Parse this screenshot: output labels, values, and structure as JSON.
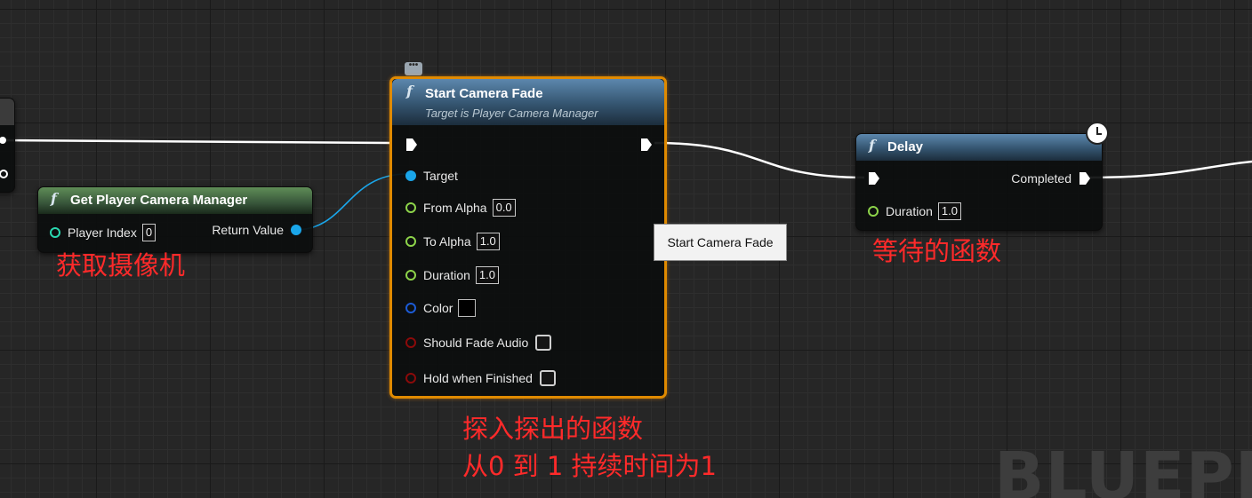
{
  "nodes": {
    "get_camera_manager": {
      "title": "Get Player Camera Manager",
      "player_index_label": "Player Index",
      "player_index_value": "0",
      "return_value_label": "Return Value"
    },
    "start_camera_fade": {
      "title": "Start Camera Fade",
      "subtitle": "Target is Player Camera Manager",
      "target_label": "Target",
      "from_alpha_label": "From Alpha",
      "from_alpha_value": "0.0",
      "to_alpha_label": "To Alpha",
      "to_alpha_value": "1.0",
      "duration_label": "Duration",
      "duration_value": "1.0",
      "color_label": "Color",
      "color_value": "#000000",
      "should_fade_audio_label": "Should Fade Audio",
      "should_fade_audio_checked": false,
      "hold_when_finished_label": "Hold when Finished",
      "hold_when_finished_checked": false
    },
    "delay": {
      "title": "Delay",
      "completed_label": "Completed",
      "duration_label": "Duration",
      "duration_value": "1.0"
    }
  },
  "tooltip": {
    "text": "Start Camera Fade"
  },
  "annotations": {
    "get_camera": "获取摄像机",
    "delay_fn": "等待的函数",
    "fade_fn_line1": "探入探出的函数",
    "fade_fn_line2": "从0 到 1 持续时间为1"
  },
  "watermark": "BLUEPRINT",
  "colors": {
    "selection": "#e08a00",
    "exec_wire": "#ffffff",
    "object_pin": "#1aa6ea",
    "float_pin": "#8dd44a",
    "struct_pin": "#1c5bd6",
    "bool_pin": "#8b0a0a",
    "int_pin": "#2ad8b0",
    "annotation": "#ff2a2a"
  },
  "icons": [
    "function-icon",
    "exec-pin-icon",
    "comment-bubble-icon",
    "clock-icon"
  ]
}
